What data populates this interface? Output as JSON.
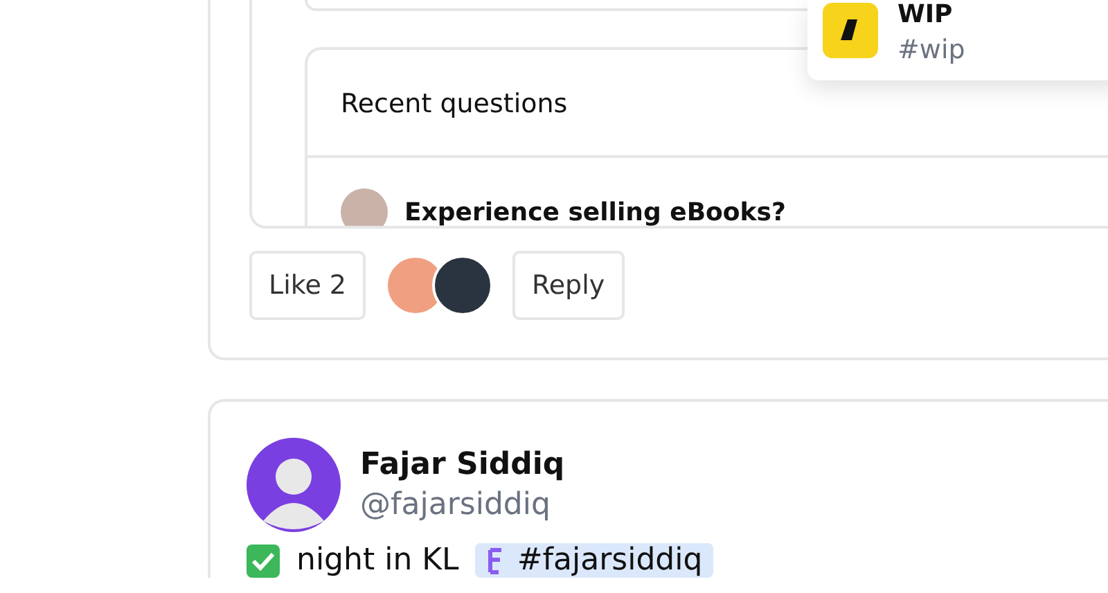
{
  "popup": {
    "title": "WIP",
    "tag": "#wip"
  },
  "post1": {
    "embed": {
      "title": "Recent questions",
      "questions": [
        {
          "title": "Experience selling eBooks?"
        }
      ]
    },
    "like_button": "Like 2",
    "reply_button": "Reply"
  },
  "post2": {
    "author": {
      "name": "Fajar Siddiq",
      "handle": "@fajarsiddiq"
    },
    "text": "night in KL",
    "tag": "#fajarsiddiq"
  }
}
